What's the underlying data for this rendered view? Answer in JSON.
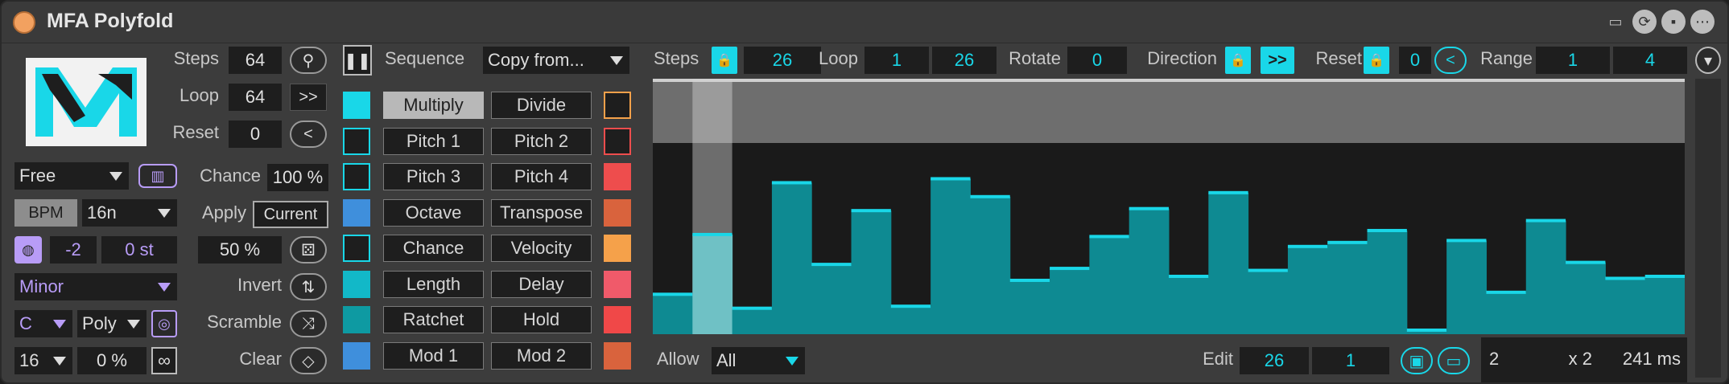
{
  "window": {
    "title": "MFA Polyfold"
  },
  "left": {
    "steps_label": "Steps",
    "steps_value": "64",
    "loop_label": "Loop",
    "loop_value": "64",
    "loop_btn": ">>",
    "reset_label": "Reset",
    "reset_value": "0",
    "reset_btn": "<",
    "mode": "Free",
    "bpm_label": "BPM",
    "rate": "16n",
    "transpose": "-2",
    "semitones": "0 st",
    "scale": "Minor",
    "key": "C",
    "voice": "Poly",
    "length": "16",
    "percent": "0 %",
    "chance_label": "Chance",
    "chance_value": "100 %",
    "apply_label": "Apply",
    "apply_value": "Current",
    "random_value": "50 %",
    "invert_label": "Invert",
    "scramble_label": "Scramble",
    "clear_label": "Clear"
  },
  "middle": {
    "sequence_label": "Sequence",
    "copy_from": "Copy from...",
    "tabs_left": [
      "Multiply",
      "Pitch 1",
      "Pitch 3",
      "Octave",
      "Chance",
      "Length",
      "Ratchet",
      "Mod 1"
    ],
    "tabs_right": [
      "Divide",
      "Pitch 2",
      "Pitch 4",
      "Transpose",
      "Velocity",
      "Delay",
      "Hold",
      "Mod 2"
    ],
    "active_tab": "Multiply"
  },
  "seq": {
    "steps_label": "Steps",
    "steps_value": "26",
    "loop_label": "Loop",
    "loop_start": "1",
    "loop_end": "26",
    "rotate_label": "Rotate",
    "rotate_value": "0",
    "direction_label": "Direction",
    "direction_value": ">>",
    "reset_label": "Reset",
    "reset_value": "0",
    "reset_btn": "<",
    "range_label": "Range",
    "range_min": "1",
    "range_max": "4",
    "allow_label": "Allow",
    "allow_value": "All",
    "edit_label": "Edit",
    "edit_step": "26",
    "edit_value": "1",
    "info_value": "2",
    "info_mult": "x 2",
    "info_ms": "241 ms"
  },
  "colors": {
    "accent": "#19d7e8",
    "bar": "#0e8a92",
    "highlight_bar": "#6fc1c5",
    "left_swatches": [
      "#19d7e8",
      "#1e1e1e",
      "#1e1e1e",
      "#3f8fdc",
      "#1e1e1e",
      "#12b8c8",
      "#0e9aa2",
      "#3f8fdc"
    ],
    "right_swatches": [
      "#1e1e1e",
      "#1e1e1e",
      "#ee4d4d",
      "#d9633d",
      "#f5a14a",
      "#f05a6a",
      "#f04848",
      "#d9633d"
    ]
  },
  "chart_data": {
    "type": "bar",
    "x": [
      1,
      2,
      3,
      4,
      5,
      6,
      7,
      8,
      9,
      10,
      11,
      12,
      13,
      14,
      15,
      16,
      17,
      18,
      19,
      20,
      21,
      22,
      23,
      24,
      25,
      26
    ],
    "values": [
      0.16,
      0.46,
      0.09,
      0.72,
      0.31,
      0.58,
      0.1,
      0.74,
      0.65,
      0.23,
      0.29,
      0.45,
      0.59,
      0.25,
      0.67,
      0.28,
      0.4,
      0.42,
      0.48,
      -0.02,
      0.43,
      0.17,
      0.53,
      0.32,
      0.24,
      0.25
    ],
    "ylim": [
      0,
      1
    ],
    "highlight_step": 2
  },
  "icons": [
    "key-icon",
    "piano-icon",
    "globe-icon",
    "drum-icon",
    "infinity-icon",
    "dice-icon",
    "swap-icon",
    "shuffle-icon",
    "eraser-icon",
    "pause-icon",
    "lock-icon",
    "save-icon",
    "folder-icon",
    "refresh-icon",
    "menu-icon"
  ]
}
